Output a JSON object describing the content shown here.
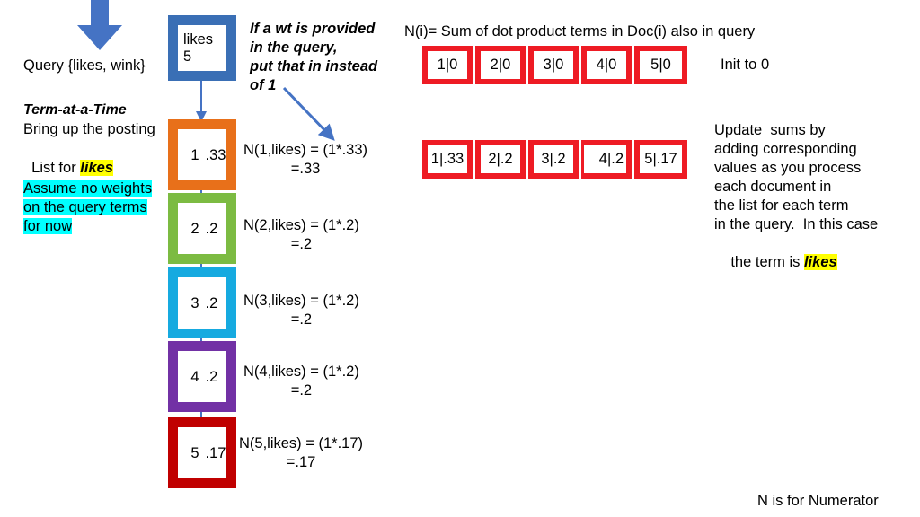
{
  "slide": {
    "title_note": "N is for Numerator",
    "left": {
      "query_line": "Query {likes, wink}",
      "term_at_a_time": "Term-at-a-Time",
      "bring_up_line1": "Bring up the posting",
      "bring_up_line2_prefix": "List for ",
      "bring_up_line2_term": "likes",
      "assume_line1": "Assume no weights",
      "assume_line2": "on the query terms",
      "assume_line3": "for now"
    },
    "wt_note": {
      "line1": "If a wt is provided",
      "line2": "in the query,",
      "line3": "put that in instead",
      "line4": "of 1"
    },
    "posting_list": {
      "header": {
        "term": "likes",
        "df": "5",
        "color": "#3a6fb5"
      },
      "entries": [
        {
          "doc": "1",
          "weight": ".33",
          "color": "#e8701a"
        },
        {
          "doc": "2",
          "weight": ".2",
          "color": "#7cbb42"
        },
        {
          "doc": "3",
          "weight": ".2",
          "color": "#16aae0"
        },
        {
          "doc": "4",
          "weight": ".2",
          "color": "#7231a5"
        },
        {
          "doc": "5",
          "weight": ".17",
          "color": "#c00000"
        }
      ]
    },
    "computations": [
      {
        "expr": "N(1,likes) = (1*.33)",
        "result": "=.33"
      },
      {
        "expr": "N(2,likes) = (1*.2)",
        "result": "=.2"
      },
      {
        "expr": "N(3,likes) = (1*.2)",
        "result": "=.2"
      },
      {
        "expr": "N(4,likes) = (1*.2)",
        "result": "=.2"
      },
      {
        "expr": "N(5,likes) = (1*.17)",
        "result": "=.17"
      }
    ],
    "right": {
      "definition": "N(i)= Sum of dot product terms in Doc(i) also in query",
      "init_label": "Init to 0",
      "accumulators_init": [
        "1|0",
        "2|0",
        "3|0",
        "4|0",
        "5|0"
      ],
      "accumulators_updated": [
        "1|.33",
        "2|.2",
        "3|.2",
        "4|.2",
        "5|.17"
      ],
      "update_note": {
        "line1": "Update  sums by",
        "line2": "adding corresponding",
        "line3": "values as you process",
        "line4": "each document in",
        "line5": "the list for each term",
        "line6_prefix": "in the query.  In this case",
        "line7_prefix": "the term is ",
        "line7_term": "likes"
      }
    },
    "colors": {
      "accent_blue": "#4573c4",
      "accumulator_red": "#ee1b24",
      "highlight_yellow": "#ffff00",
      "highlight_cyan": "#00ffff"
    }
  }
}
